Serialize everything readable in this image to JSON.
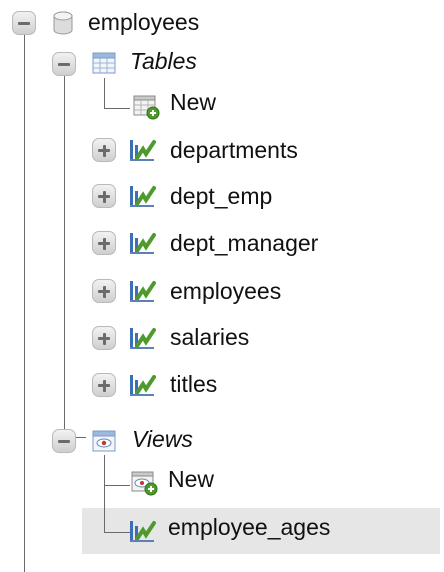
{
  "tree": {
    "database": {
      "label": "employees"
    },
    "tables": {
      "label": "Tables",
      "new_label": "New",
      "items": [
        {
          "label": "departments"
        },
        {
          "label": "dept_emp"
        },
        {
          "label": "dept_manager"
        },
        {
          "label": "employees"
        },
        {
          "label": "salaries"
        },
        {
          "label": "titles"
        }
      ]
    },
    "views": {
      "label": "Views",
      "new_label": "New",
      "items": [
        {
          "label": "employee_ages"
        }
      ]
    }
  },
  "colors": {
    "selection_bg": "#e6e6e6",
    "tree_line": "#6a6a6a",
    "table_icon_green": "#4f9a2c",
    "table_icon_blue": "#3b6fb6"
  },
  "icons": {
    "database": "database-icon",
    "tables_group": "tables-folder-icon",
    "new_table": "new-table-icon",
    "table": "table-icon",
    "views_group": "views-folder-icon",
    "new_view": "new-view-icon",
    "view": "view-icon"
  }
}
